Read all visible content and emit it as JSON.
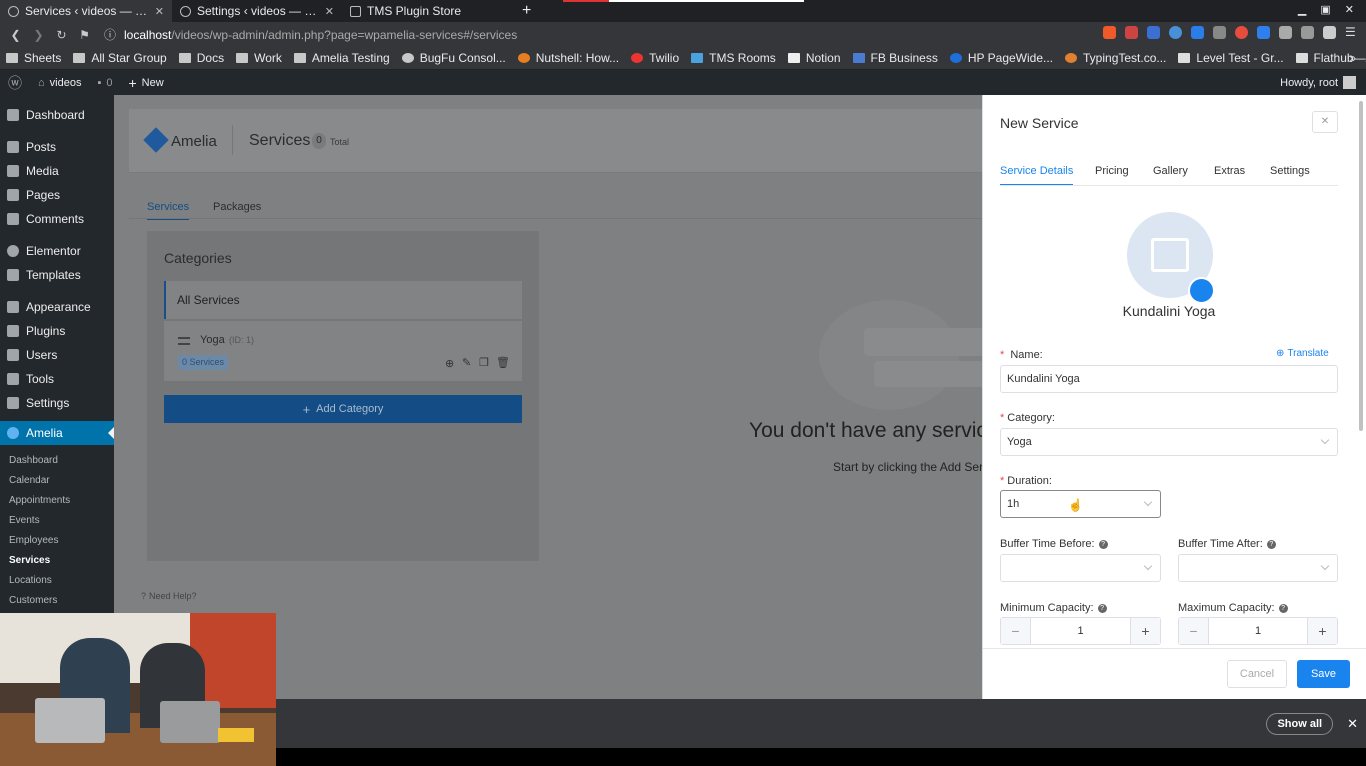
{
  "browser": {
    "tabs": [
      {
        "label": "Services ‹ videos — WordPress",
        "active": true
      },
      {
        "label": "Settings ‹ videos — WordPress",
        "active": false
      },
      {
        "label": "TMS Plugin Store",
        "active": false
      }
    ],
    "url_host": "localhost",
    "url_path": "/videos/wp-admin/admin.php?page=wpamelia-services#/services",
    "bookmarks": [
      "Sheets",
      "All Star Group",
      "Docs",
      "Work",
      "Amelia Testing",
      "BugFu Consol...",
      "Nutshell: How...",
      "Twilio",
      "TMS Rooms",
      "Notion",
      "FB Business",
      "HP PageWide...",
      "TypingTest.co...",
      "Level Test - Gr...",
      "Flathub—An a..."
    ],
    "download_bar": {
      "show_all": "Show all"
    }
  },
  "admin_bar": {
    "site": "videos",
    "comments": "0",
    "new": "New",
    "greeting": "Howdy, root"
  },
  "wp_menu": {
    "items": [
      "Dashboard",
      "Posts",
      "Media",
      "Pages",
      "Comments",
      "Elementor",
      "Templates",
      "Appearance",
      "Plugins",
      "Users",
      "Tools",
      "Settings"
    ],
    "amelia": "Amelia",
    "amelia_sub": [
      "Dashboard",
      "Calendar",
      "Appointments",
      "Events",
      "Employees",
      "Services",
      "Locations",
      "Customers"
    ],
    "current_sub": "Services"
  },
  "amelia_page": {
    "logo": "Amelia",
    "title": "Services",
    "count": "0",
    "count_label": "Total",
    "tabs": [
      "Services",
      "Packages"
    ],
    "categories_title": "Categories",
    "all_services": "All Services",
    "category": {
      "name": "Yoga",
      "id_label": "(ID: 1)",
      "services_badge": "0 Services"
    },
    "add_category": "Add Category",
    "empty_title": "You don't have any servic",
    "empty_sub": "Start by clicking the Add Servi",
    "need_help": "Need Help?"
  },
  "drawer": {
    "title": "New Service",
    "tabs": [
      "Service Details",
      "Pricing",
      "Gallery",
      "Extras",
      "Settings"
    ],
    "service_name_display": "Kundalini Yoga",
    "translate": "Translate",
    "name_label": "Name:",
    "name_value": "Kundalini Yoga",
    "category_label": "Category:",
    "category_value": "Yoga",
    "duration_label": "Duration:",
    "duration_value": "1h",
    "buffer_before_label": "Buffer Time Before:",
    "buffer_after_label": "Buffer Time After:",
    "min_capacity_label": "Minimum Capacity:",
    "max_capacity_label": "Maximum Capacity:",
    "min_capacity": "1",
    "max_capacity": "1",
    "cancel": "Cancel",
    "save": "Save",
    "accent": "#1a84ee"
  }
}
